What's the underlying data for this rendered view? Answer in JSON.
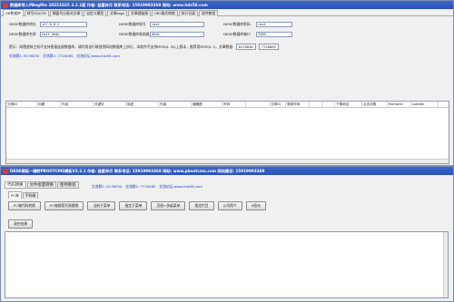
{
  "window1": {
    "title": "数据库导入PBegfite 20221025 3.2.1版 作者: 益星林月 联系电话: 15919993369 网站: www.hdz58.com",
    "tabs": [
      "DB数据库",
      "转写SQLITE",
      "蜗窗号分表对文章",
      "自定义模型",
      "文章tags",
      "文章搜链接",
      "URL格式转换",
      "执行记录",
      "软件教程"
    ],
    "fields": [
      {
        "label": "DEDE数据库地址",
        "value": "127.0.0.1"
      },
      {
        "label": "DEDE数据库账号",
        "value": "root"
      },
      {
        "label": "DEDE数据库密码",
        "value": "root"
      },
      {
        "label": "DEDE数据库名称",
        "value": "test_dede"
      },
      {
        "label": "DEDE数据库表前缀",
        "value": "dede_"
      },
      {
        "label": "DEDE数据库端口",
        "value": "3306"
      }
    ],
    "status_prefix": "提示：网替虚拟主机不支持直接连接数据库，请利用自行联接到网站数据库上执行，本软件不支持MYSQL 5以上版本，推荐用MYSQL 5，文章数量:",
    "count_a": "8176030",
    "count_b": "7720065",
    "qq_links": [
      "交流群1: 8176030",
      "交流群2: 7720065",
      "交流论坛:www.hdz58.com"
    ],
    "columns": [
      "分类ID",
      "标题",
      "内容",
      "关键字",
      "描述",
      "作者",
      "缩略图",
      "时间",
      "",
      "文章ID",
      "更新时间",
      "",
      "",
      "下载地址",
      "点击次数",
      "filename",
      "subtitle"
    ]
  },
  "window2": {
    "title": "DEDE模板一键转PBOOTCMS模板V3.2.1 作者: 益星林月 联系电话: 15919993369 网站: www.pbootcms.com 网站建设: 15919993369",
    "qq_links": [
      "交流群1: 8176030",
      "交流群2: 7720065",
      "交流论坛:www.hdz58.com"
    ],
    "groups": [
      "代码转换",
      "文件批量转换",
      "使用教程"
    ],
    "subtabs": [
      "PC端",
      "手机端"
    ],
    "buttons": [
      "PC端代码转换",
      "PC端搜索列表替换",
      "当前子菜单",
      "指定子菜单",
      "页眉+多级菜单",
      "指定栏目",
      "公司简介",
      "if语句"
    ],
    "clear_button": "清空结果"
  }
}
